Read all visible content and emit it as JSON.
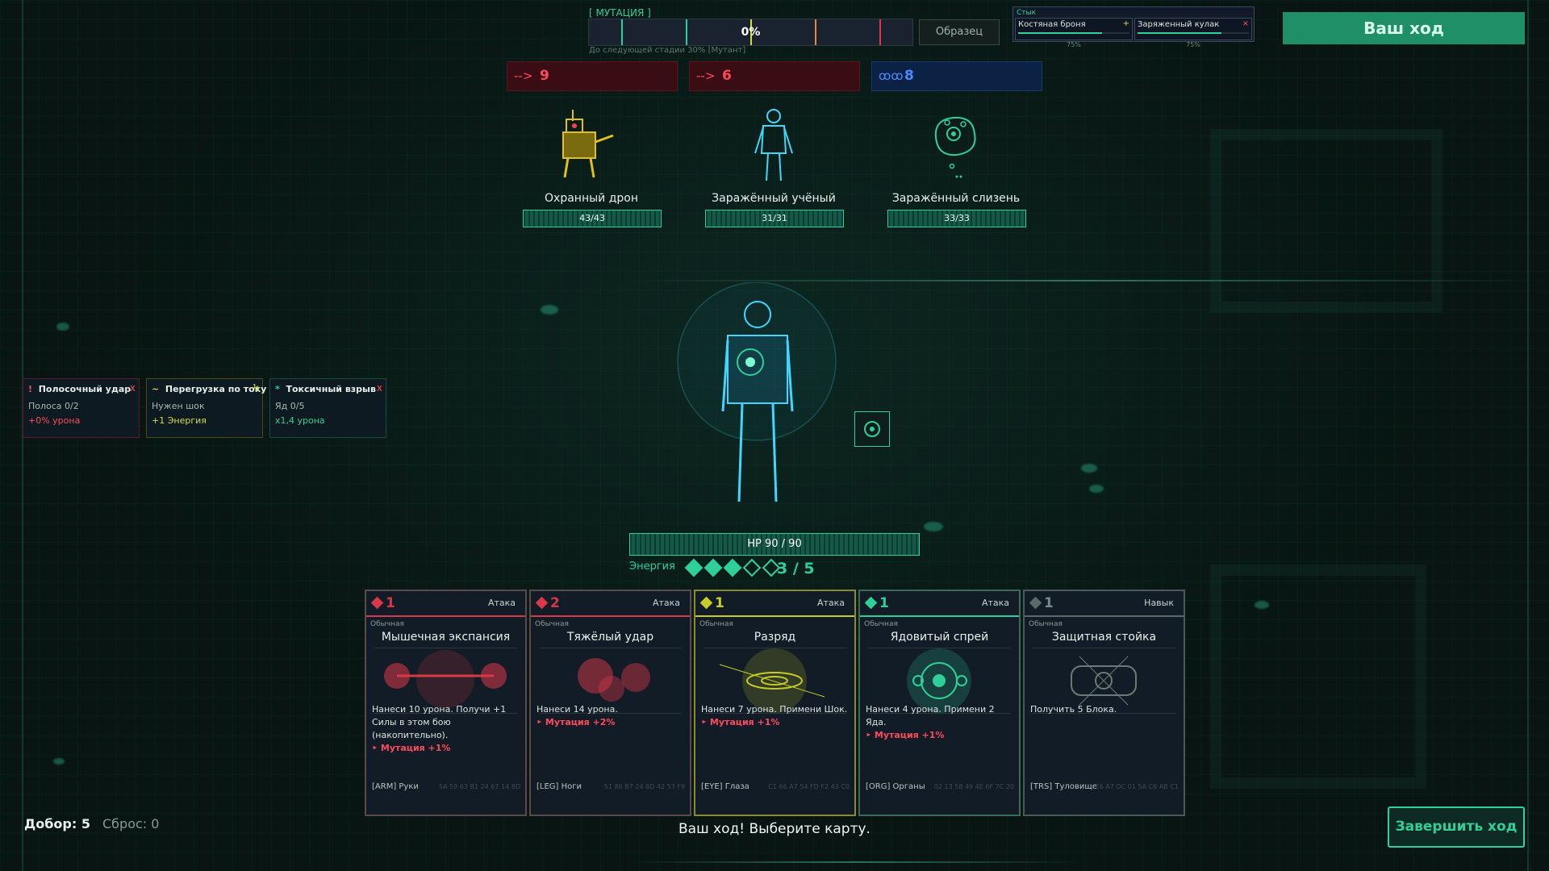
{
  "mutation": {
    "label": "[ МУТАЦИЯ ]",
    "percent": "0%",
    "fill_fraction": 0,
    "next_stage": "До следующей стадии 30% [Мутант]",
    "sample_button": "Образец"
  },
  "joint": {
    "title": "Стык",
    "slots": [
      {
        "name": "Костяная броня",
        "mark": "+",
        "percent": "75%",
        "fill_fraction": 0.75
      },
      {
        "name": "Заряженный кулак",
        "mark": "×",
        "percent": "75%",
        "fill_fraction": 0.75
      }
    ]
  },
  "turn_banner": "Ваш ход",
  "intents": [
    {
      "icon": "-->",
      "value": "9",
      "color": "#ff4a5c"
    },
    {
      "icon": "-->",
      "value": "6",
      "color": "#ff4a5c"
    },
    {
      "icon": "ꝏꝏ",
      "value": "8",
      "color": "#4a8aff"
    }
  ],
  "enemies": [
    {
      "name": "Охранный дрон",
      "hp": "43/43"
    },
    {
      "name": "Заражённый учёный",
      "hp": "31/31"
    },
    {
      "name": "Заражённый слизень",
      "hp": "33/33"
    }
  ],
  "combos": [
    {
      "icon": "!",
      "title": "Полосочный удар",
      "close": "x",
      "line1": "Полоса 0/2",
      "line2": "+0% урона",
      "color": "#ff4a5c"
    },
    {
      "icon": "~",
      "title": "Перегрузка по току",
      "close": "Ϟ",
      "line1": "Нужен шок",
      "line2": "+1 Энергия",
      "color": "#d6dd3a"
    },
    {
      "icon": "*",
      "title": "Токсичный взрыв",
      "close": "x",
      "line1": "Яд 0/5",
      "line2": "x1,4 урона",
      "color": "#2fcf9a"
    }
  ],
  "player": {
    "hp": "HP  90 / 90",
    "energy_label": "Энергия",
    "energy": "3 / 5",
    "energy_current": 3,
    "energy_max": 5
  },
  "cards": [
    {
      "cost": "1",
      "type": "Атака",
      "rarity": "Обычная",
      "name": "Мышечная экспансия",
      "desc": "Нанеси 10 урона. Получи +1 Силы в этом бою (накопительно).",
      "mut": "Мутация +1%",
      "slot": "[ARM] Руки",
      "code": "5A 59 63 B1 24 67 14 8D",
      "color": "#d83848"
    },
    {
      "cost": "2",
      "type": "Атака",
      "rarity": "Обычная",
      "name": "Тяжёлый удар",
      "desc": "Нанеси 14 урона.",
      "mut": "Мутация +2%",
      "slot": "[LEG] Ноги",
      "code": "51 86 B7 24 8D 42 53 F9",
      "color": "#d83848"
    },
    {
      "cost": "1",
      "type": "Атака",
      "rarity": "Обычная",
      "name": "Разряд",
      "desc": "Нанеси 7 урона. Примени Шок.",
      "mut": "Мутация +1%",
      "slot": "[EYE] Глаза",
      "code": "C1 66 A7 54 FD F2 43 C0",
      "color": "#c8cc28"
    },
    {
      "cost": "1",
      "type": "Атака",
      "rarity": "Обычная",
      "name": "Ядовитый спрей",
      "desc": "Нанеси 4 урона. Примени 2 Яда.",
      "mut": "Мутация +1%",
      "slot": "[ORG] Органы",
      "code": "02 13 58 49 4E 6F 7C 20",
      "color": "#2fcf9a"
    },
    {
      "cost": "1",
      "type": "Навык",
      "rarity": "Обычная",
      "name": "Защитная стойка",
      "desc": "Получить 5 Блока.",
      "mut": "",
      "slot": "[TRS] Туловище",
      "code": "E6 A7 DC 01 5A C6 AB C1",
      "color": "#5a6a66"
    }
  ],
  "draw": "Добор: 5",
  "discard": "Сброс: 0",
  "status": "Ваш ход! Выберите карту.",
  "end_turn": "Завершить ход"
}
